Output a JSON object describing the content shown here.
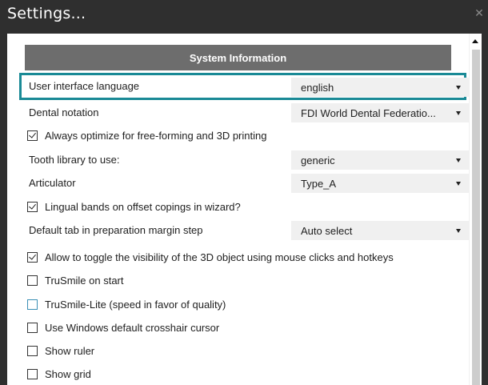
{
  "window": {
    "title": "Settings...",
    "close_glyph": "✕"
  },
  "section": {
    "title": "System Information"
  },
  "rows": {
    "ui_language": {
      "label": "User interface language",
      "value": "english"
    },
    "dental_notation": {
      "label": "Dental notation",
      "value": "FDI World Dental Federatio..."
    },
    "tooth_library": {
      "label": "Tooth library to use:",
      "value": "generic"
    },
    "articulator": {
      "label": "Articulator",
      "value": "Type_A"
    },
    "default_tab": {
      "label": "Default tab in preparation margin step",
      "value": "Auto select"
    }
  },
  "checks": {
    "optimize": {
      "label": "Always optimize for free-forming and 3D printing",
      "checked": true
    },
    "lingual": {
      "label": "Lingual bands on offset copings in wizard?",
      "checked": true
    },
    "toggle_visibility": {
      "label": "Allow to toggle the visibility of the 3D object using mouse clicks and hotkeys",
      "checked": true
    },
    "trusmile": {
      "label": "TruSmile on start",
      "checked": false
    },
    "trusmile_lite": {
      "label": "TruSmile-Lite (speed in favor of quality)",
      "checked": false
    },
    "crosshair": {
      "label": "Use Windows default crosshair cursor",
      "checked": false
    },
    "ruler": {
      "label": "Show ruler",
      "checked": false
    },
    "grid": {
      "label": "Show grid",
      "checked": false
    }
  },
  "colors": {
    "highlight": "#1a8a96",
    "header_bg": "#6d6d6d",
    "titlebar_bg": "#2f2f2f"
  }
}
